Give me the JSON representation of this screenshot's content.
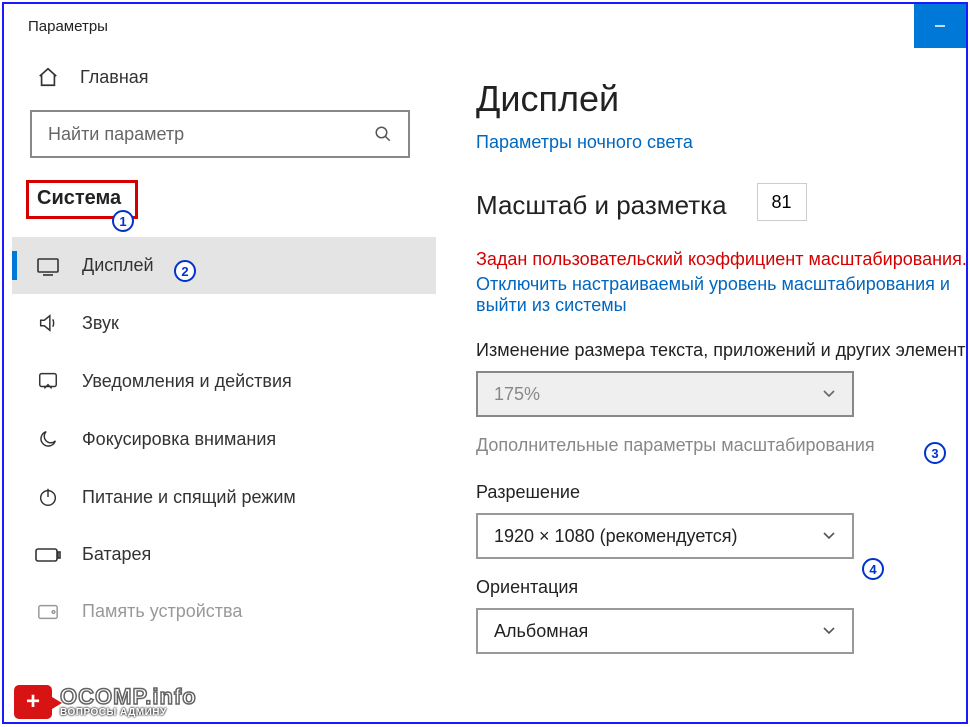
{
  "window": {
    "title": "Параметры"
  },
  "sidebar": {
    "home": "Главная",
    "search_placeholder": "Найти параметр",
    "section": "Система",
    "items": [
      {
        "label": "Дисплей"
      },
      {
        "label": "Звук"
      },
      {
        "label": "Уведомления и действия"
      },
      {
        "label": "Фокусировка внимания"
      },
      {
        "label": "Питание и спящий режим"
      },
      {
        "label": "Батарея"
      },
      {
        "label": "Память устройства"
      }
    ]
  },
  "content": {
    "title": "Дисплей",
    "night_light_link": "Параметры ночного света",
    "scale_heading": "Масштаб и разметка",
    "zoom_value": "81",
    "warning": "Задан пользовательский коэффициент масштабирования.",
    "disable_line1": "Отключить настраиваемый уровень масштабирования и",
    "disable_line2": "выйти из системы",
    "scale_label": "Изменение размера текста, приложений и других элементов",
    "scale_value": "175%",
    "advanced_scaling": "Дополнительные параметры масштабирования",
    "resolution_label": "Разрешение",
    "resolution_value": "1920 × 1080 (рекомендуется)",
    "orientation_label": "Ориентация",
    "orientation_value": "Альбомная"
  },
  "callouts": {
    "n1": "1",
    "n2": "2",
    "n3": "3",
    "n4": "4"
  },
  "watermark": {
    "line1": "OCOMP.info",
    "line2": "ВОПРОСЫ АДМИНУ",
    "badge": "+"
  }
}
